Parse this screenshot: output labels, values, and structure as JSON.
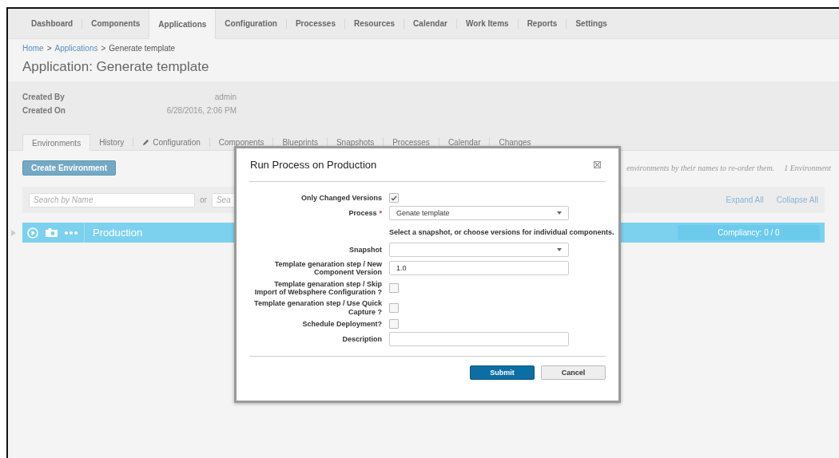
{
  "nav": [
    {
      "label": "Dashboard",
      "selected": false
    },
    {
      "label": "Components",
      "selected": false
    },
    {
      "label": "Applications",
      "selected": true
    },
    {
      "label": "Configuration",
      "selected": false
    },
    {
      "label": "Processes",
      "selected": false
    },
    {
      "label": "Resources",
      "selected": false
    },
    {
      "label": "Calendar",
      "selected": false
    },
    {
      "label": "Work Items",
      "selected": false
    },
    {
      "label": "Reports",
      "selected": false
    },
    {
      "label": "Settings",
      "selected": false
    }
  ],
  "breadcrumb": [
    {
      "kind": "link",
      "text": "Home"
    },
    {
      "kind": "separator",
      "text": ">"
    },
    {
      "kind": "link",
      "text": "Applications"
    },
    {
      "kind": "separator",
      "text": ">"
    },
    {
      "kind": "current",
      "text": "Generate template"
    }
  ],
  "page_title": "Application: Generate template",
  "details": [
    {
      "label": "Created By",
      "value": "admin"
    },
    {
      "label": "Created On",
      "value": "6/28/2016, 2:06 PM"
    }
  ],
  "subtabs": [
    {
      "label": "Environments",
      "selected": true,
      "kind": "plain"
    },
    {
      "label": "History",
      "selected": false,
      "kind": "plain"
    },
    {
      "label": "Configuration",
      "selected": false,
      "kind": "pencil"
    },
    {
      "label": "Components",
      "selected": false,
      "kind": "plain"
    },
    {
      "label": "Blueprints",
      "selected": false,
      "kind": "plain"
    },
    {
      "label": "Snapshots",
      "selected": false,
      "kind": "plain"
    },
    {
      "label": "Processes",
      "selected": false,
      "kind": "plain"
    },
    {
      "label": "Calendar",
      "selected": false,
      "kind": "plain"
    },
    {
      "label": "Changes",
      "selected": false,
      "kind": "plain"
    }
  ],
  "create_button": "Create Environment",
  "hint": "environments by their names to re-order them.",
  "count": "1 Environment",
  "filters": {
    "search_placeholder": "Search by Name",
    "or": "or",
    "second_placeholder": "Sea",
    "expand_all": "Expand All",
    "collapse_all": "Collapse All"
  },
  "environment": {
    "name": "Production",
    "compliancy": "Compliancy: 0 / 0"
  },
  "dialog": {
    "title": "Run Process on Production",
    "fields": [
      {
        "kind": "checkbox",
        "label": "Only Changed Versions",
        "checked": true
      },
      {
        "kind": "select",
        "label": "Process",
        "required_mark": "*",
        "value": "Genate template"
      },
      {
        "kind": "note",
        "text": "Select a snapshot, or choose versions for individual components."
      },
      {
        "kind": "select",
        "label": "Snapshot"
      },
      {
        "kind": "text",
        "label": "Template genaration step / New Component Version",
        "value": "1.0"
      },
      {
        "kind": "checkbox",
        "label": "Template genaration step / Skip Import of Websphere Configuration ?",
        "checked": false
      },
      {
        "kind": "checkbox",
        "label": "Template genaration step / Use Quick Capture ?",
        "checked": false
      },
      {
        "kind": "checkbox",
        "label": "Schedule Deployment?",
        "checked": false
      },
      {
        "kind": "text",
        "label": "Description"
      }
    ],
    "buttons": [
      {
        "kind": "primary",
        "label": "Submit"
      },
      {
        "kind": "secondary",
        "label": "Cancel"
      }
    ]
  }
}
